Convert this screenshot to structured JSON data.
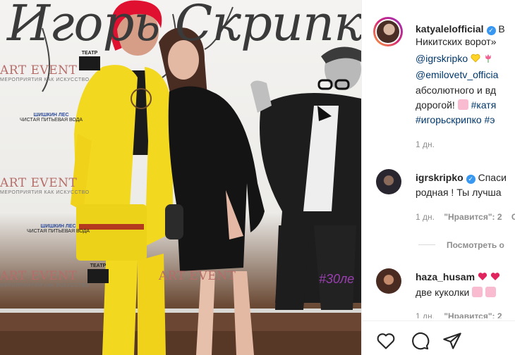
{
  "photo": {
    "banner_title": "Игорь Скрипко",
    "art_event": "ART EVENT",
    "art_event_sub": "МЕРОПРИЯТИЯ КАК ИСКУССТВО",
    "teatr": "ТЕАТР",
    "water_brand": "ШИШКИН ЛЕС",
    "water_sub": "ЧИСТАЯ ПИТЬЕВАЯ ВОДА",
    "hashtag": "#30ле"
  },
  "post": {
    "author": "katyalelofficial",
    "caption_line1_suffix": "В",
    "caption_line2": "Никитских ворот»",
    "mention1": "@igrskripko",
    "mention2": "@emilovetv_officia",
    "caption_line4": "абсолютного и вд",
    "caption_line5_prefix": "дорогой!",
    "caption_hashtag1": "#катя",
    "caption_hashtag2": "#игорьскрипко",
    "caption_hashtag3": "#э",
    "time": "1 дн."
  },
  "comments": [
    {
      "username": "igrskripko",
      "text_line1": "Спаси",
      "text_line2": "родная ! Ты лучша",
      "time": "1 дн.",
      "likes": "\"Нравится\": 2",
      "reply_prefix": "О"
    },
    {
      "username": "haza_husam",
      "text_line2": "две куколки",
      "time": "1 дн.",
      "likes": "\"Нравится\": 2"
    }
  ],
  "view_replies": "Посмотреть о",
  "actions": {
    "like": "heart-outline-icon",
    "comment": "comment-bubble-icon",
    "share": "paper-plane-icon"
  },
  "colors": {
    "link": "#00376b",
    "verified": "#3897f0",
    "meta": "#8e8e8e",
    "yellow_suit": "#f2d81f"
  }
}
